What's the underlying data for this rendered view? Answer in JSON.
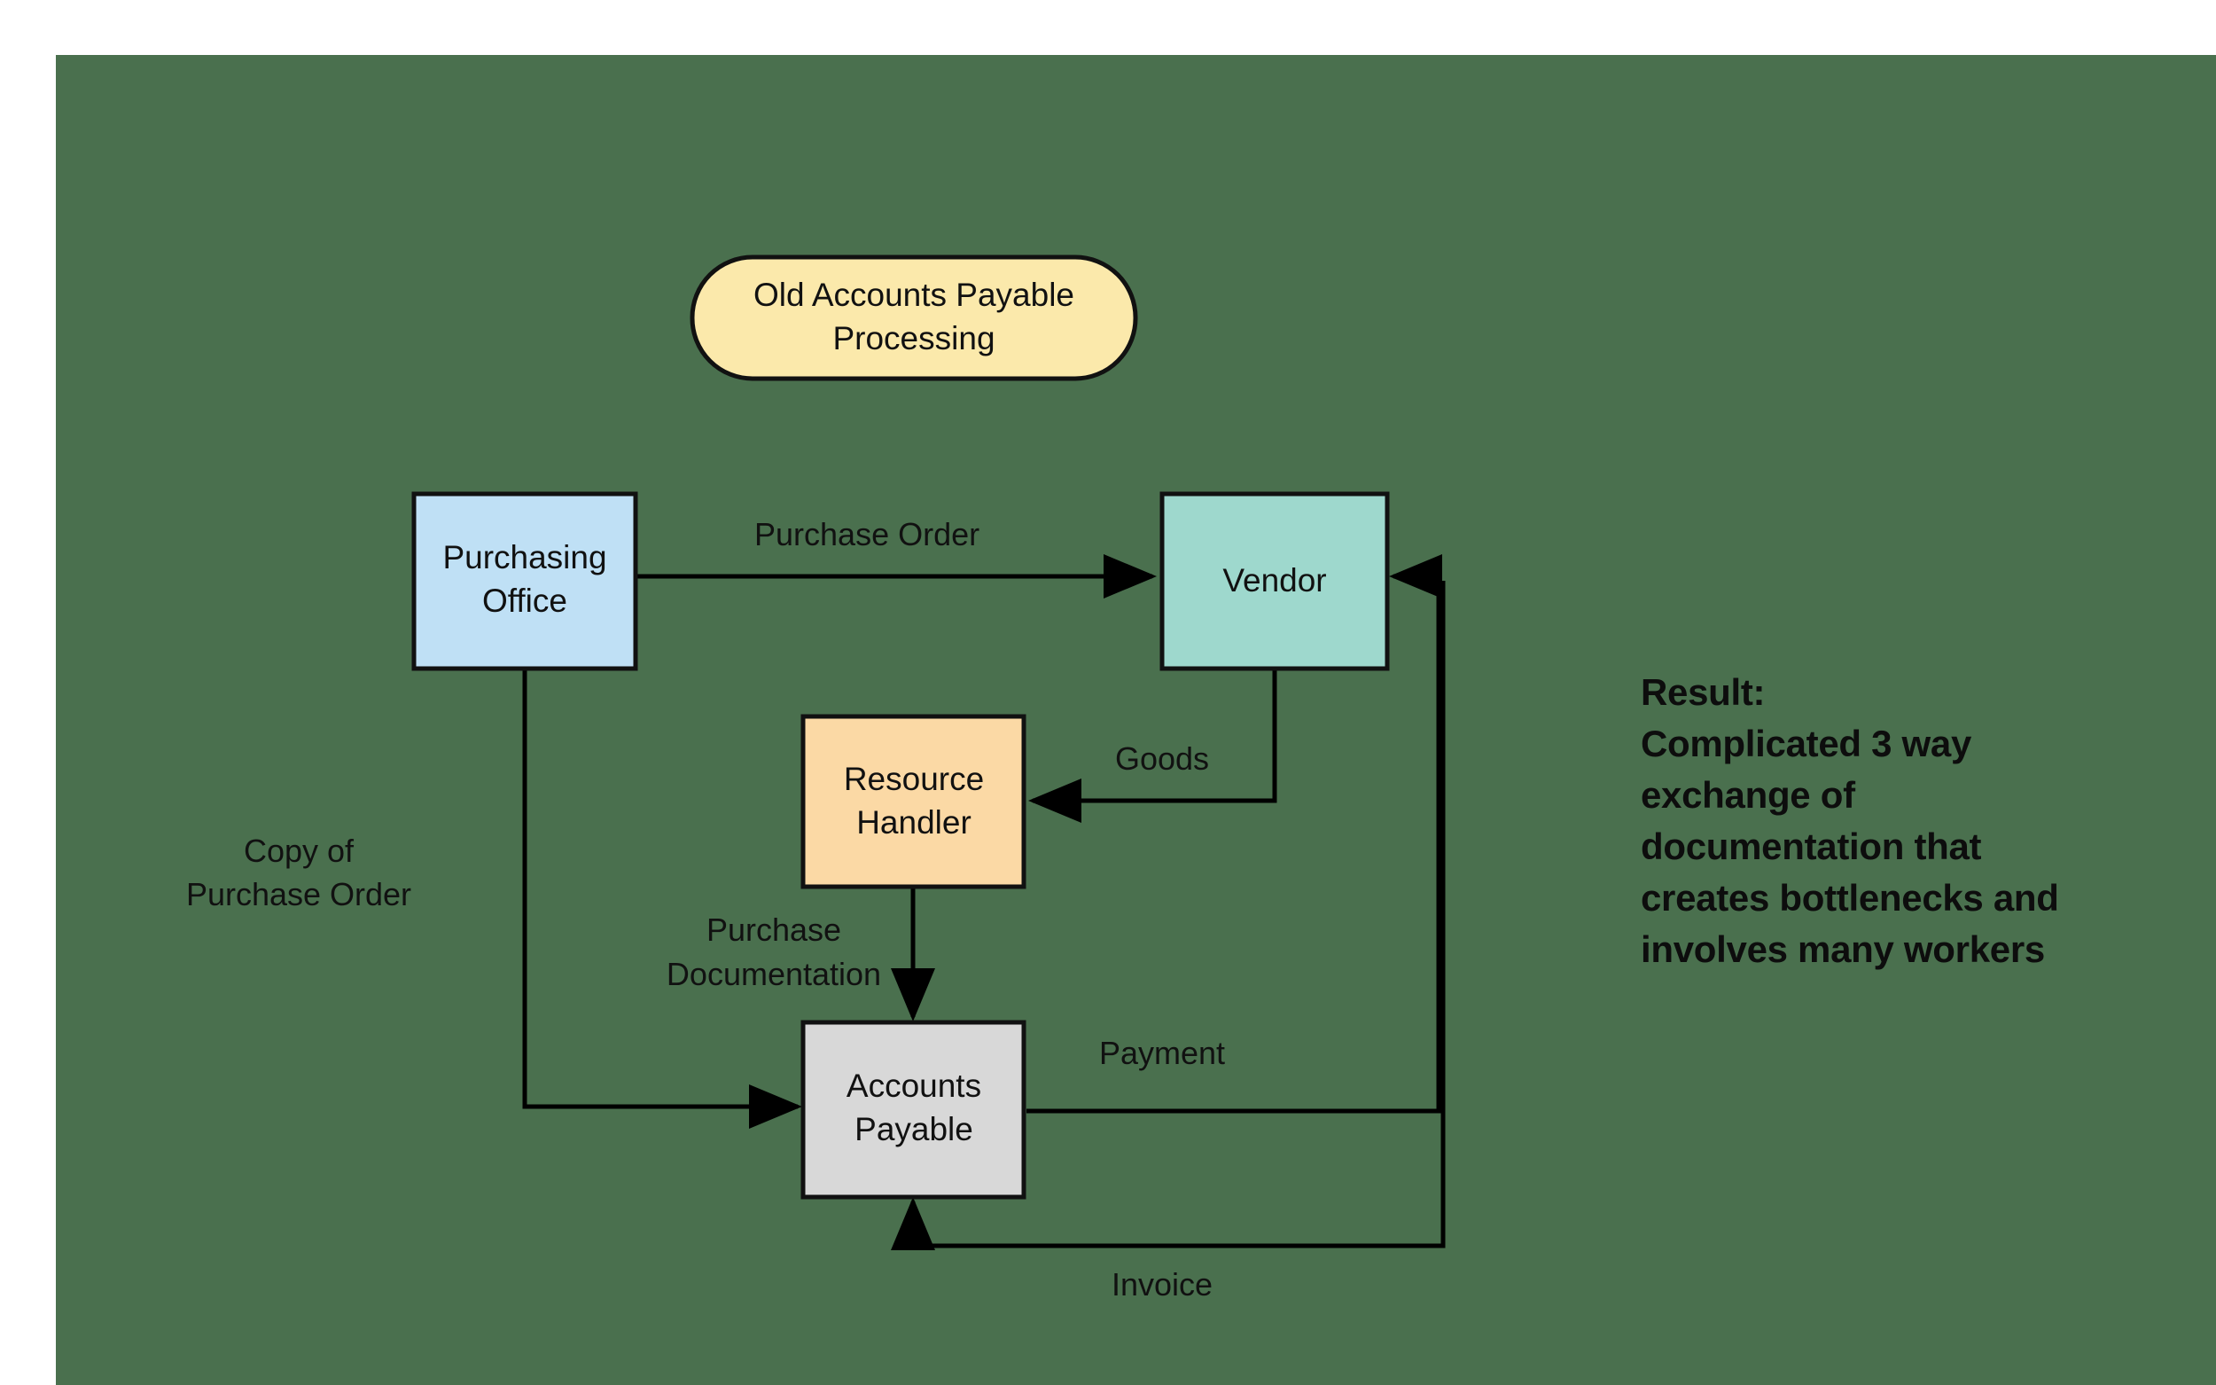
{
  "canvas": {
    "background_color": "#4a704e",
    "page_background_color": "#ffffff"
  },
  "title_node": {
    "id": "title-pill",
    "shape": "rounded-pill",
    "line1": "Old Accounts Payable",
    "line2": "Processing",
    "fill": "#fbe9ab",
    "stroke": "#000000"
  },
  "nodes": [
    {
      "id": "purchasing-office",
      "line1": "Purchasing",
      "line2": "Office",
      "fill": "#bfe0f5",
      "stroke": "#111111"
    },
    {
      "id": "vendor",
      "line1": "Vendor",
      "line2": "",
      "fill": "#9ed8cd",
      "stroke": "#111111"
    },
    {
      "id": "resource-handler",
      "line1": "Resource",
      "line2": "Handler",
      "fill": "#fbd9a5",
      "stroke": "#111111"
    },
    {
      "id": "accounts-payable",
      "line1": "Accounts",
      "line2": "Payable",
      "fill": "#d8d8d8",
      "stroke": "#111111"
    }
  ],
  "edges": [
    {
      "id": "edge-purchase-order",
      "label": "Purchase Order",
      "from": "purchasing-office",
      "to": "vendor"
    },
    {
      "id": "edge-copy-of-purchase-order",
      "label_line1": "Copy of",
      "label_line2": "Purchase Order",
      "from": "purchasing-office",
      "to": "accounts-payable"
    },
    {
      "id": "edge-goods",
      "label": "Goods",
      "from": "vendor",
      "to": "resource-handler"
    },
    {
      "id": "edge-purchase-documentation",
      "label_line1": "Purchase",
      "label_line2": "Documentation",
      "from": "resource-handler",
      "to": "accounts-payable"
    },
    {
      "id": "edge-payment",
      "label": "Payment",
      "from": "accounts-payable",
      "to": "vendor"
    },
    {
      "id": "edge-invoice",
      "label": "Invoice",
      "from": "vendor",
      "to": "accounts-payable"
    }
  ],
  "result": {
    "text": "Result:\nComplicated 3 way\nexchange of\ndocumentation that\ncreates bottlenecks and\ninvolves many workers"
  }
}
